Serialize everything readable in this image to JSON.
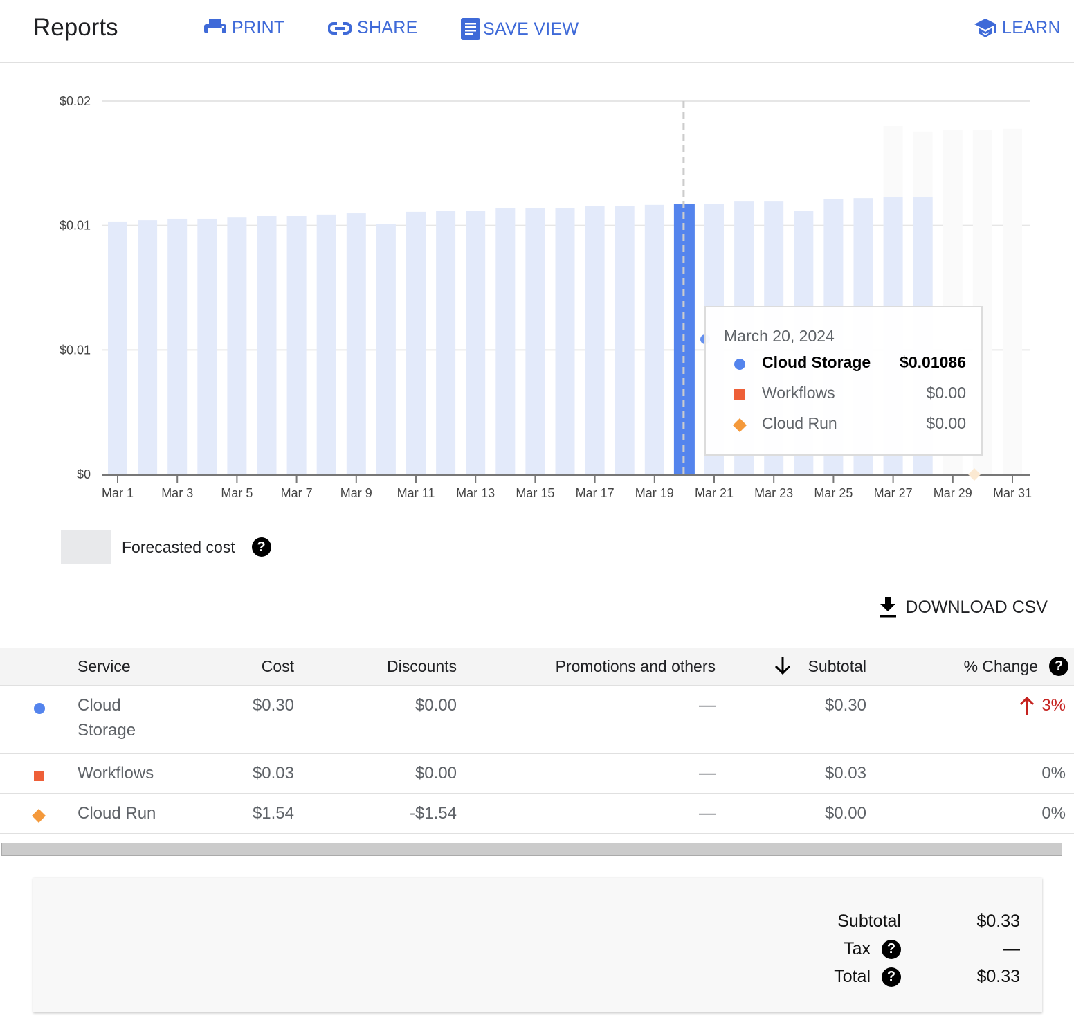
{
  "header": {
    "title": "Reports",
    "actions": [
      {
        "label": "PRINT",
        "icon": "print-icon"
      },
      {
        "label": "SHARE",
        "icon": "link-icon"
      },
      {
        "label": "SAVE VIEW",
        "icon": "document-icon"
      },
      {
        "label": "LEARN",
        "icon": "school-icon"
      }
    ]
  },
  "colors": {
    "accent": "#3f6ad8",
    "cloud_storage": "#5484ed",
    "workflows": "#ee5f38",
    "cloud_run": "#f4993b",
    "bar_light": "#e3eafa",
    "forecast": "#fafafa",
    "negative_change": "#c5221f"
  },
  "chart_data": {
    "type": "bar",
    "title": "",
    "xlabel": "",
    "ylabel": "",
    "ylim": [
      0,
      0.015
    ],
    "ytick_values": [
      0,
      0.005,
      0.01,
      0.015
    ],
    "ytick_labels": [
      "$0",
      "$0.01",
      "$0.01",
      "$0.02"
    ],
    "categories": [
      "Mar 1",
      "Mar 2",
      "Mar 3",
      "Mar 4",
      "Mar 5",
      "Mar 6",
      "Mar 7",
      "Mar 8",
      "Mar 9",
      "Mar 10",
      "Mar 11",
      "Mar 12",
      "Mar 13",
      "Mar 14",
      "Mar 15",
      "Mar 16",
      "Mar 17",
      "Mar 18",
      "Mar 19",
      "Mar 20",
      "Mar 21",
      "Mar 22",
      "Mar 23",
      "Mar 24",
      "Mar 25",
      "Mar 26",
      "Mar 27",
      "Mar 28",
      "Mar 29",
      "Mar 30",
      "Mar 31"
    ],
    "xtick_labels": [
      "Mar 1",
      "Mar 3",
      "Mar 5",
      "Mar 7",
      "Mar 9",
      "Mar 11",
      "Mar 13",
      "Mar 15",
      "Mar 17",
      "Mar 19",
      "Mar 21",
      "Mar 23",
      "Mar 25",
      "Mar 27",
      "Mar 29",
      "Mar 31"
    ],
    "series": [
      {
        "name": "Cloud Storage",
        "values": [
          0.01016,
          0.01021,
          0.01027,
          0.01027,
          0.01032,
          0.01038,
          0.01038,
          0.01044,
          0.01049,
          0.01005,
          0.01055,
          0.0106,
          0.0106,
          0.01071,
          0.01071,
          0.01071,
          0.01077,
          0.01077,
          0.01083,
          0.01086,
          0.01088,
          0.01099,
          0.01099,
          0.0106,
          0.01105,
          0.0111,
          0.01116,
          0.01116,
          null,
          null,
          null
        ]
      },
      {
        "name": "Workflows",
        "values": [
          0,
          0,
          0,
          0,
          0,
          0,
          0,
          0,
          0,
          0,
          0,
          0,
          0,
          0,
          0,
          0,
          0,
          0,
          0,
          0,
          0,
          0,
          0,
          0,
          0,
          0,
          0,
          0,
          null,
          null,
          null
        ]
      },
      {
        "name": "Cloud Run",
        "values": [
          0,
          0,
          0,
          0,
          0,
          0,
          0,
          0,
          0,
          0,
          0,
          0,
          0,
          0,
          0,
          0,
          0,
          0,
          0,
          0,
          0,
          0,
          0,
          0,
          0,
          0,
          0,
          0,
          null,
          null,
          null
        ]
      },
      {
        "name": "Forecasted cost",
        "values": [
          null,
          null,
          null,
          null,
          null,
          null,
          null,
          null,
          null,
          null,
          null,
          null,
          null,
          null,
          null,
          null,
          null,
          null,
          null,
          null,
          null,
          null,
          null,
          null,
          null,
          null,
          0.014,
          0.01378,
          0.01383,
          0.01383,
          0.01389
        ]
      }
    ],
    "highlighted_category": "Mar 20",
    "grid": true,
    "legend": [
      {
        "label": "Forecasted cost",
        "position": "bottom-left"
      }
    ]
  },
  "tooltip": {
    "date": "March 20, 2024",
    "rows": [
      {
        "name": "Cloud Storage",
        "value": "$0.01086",
        "marker": "circle"
      },
      {
        "name": "Workflows",
        "value": "$0.00",
        "marker": "square"
      },
      {
        "name": "Cloud Run",
        "value": "$0.00",
        "marker": "diamond"
      }
    ]
  },
  "legend": {
    "forecast_label": "Forecasted cost",
    "help": "?"
  },
  "download": {
    "label": "DOWNLOAD CSV"
  },
  "table": {
    "columns": [
      "Service",
      "Cost",
      "Discounts",
      "Promotions and others",
      "Subtotal",
      "% Change"
    ],
    "help": "?",
    "rows": [
      {
        "service_line1": "Cloud",
        "service_line2": "Storage",
        "cost": "$0.30",
        "discounts": "$0.00",
        "promotions": "—",
        "subtotal": "$0.30",
        "change": "3%",
        "change_dir": "up",
        "marker": "circle"
      },
      {
        "service_line1": "Workflows",
        "service_line2": "",
        "cost": "$0.03",
        "discounts": "$0.00",
        "promotions": "—",
        "subtotal": "$0.03",
        "change": "0%",
        "marker": "square"
      },
      {
        "service_line1": "Cloud Run",
        "service_line2": "",
        "cost": "$1.54",
        "discounts": "-$1.54",
        "promotions": "—",
        "subtotal": "$0.00",
        "change": "0%",
        "marker": "diamond"
      }
    ]
  },
  "totals": {
    "subtotal_label": "Subtotal",
    "subtotal_value": "$0.33",
    "tax_label": "Tax",
    "tax_value": "—",
    "total_label": "Total",
    "total_value": "$0.33",
    "help": "?"
  }
}
